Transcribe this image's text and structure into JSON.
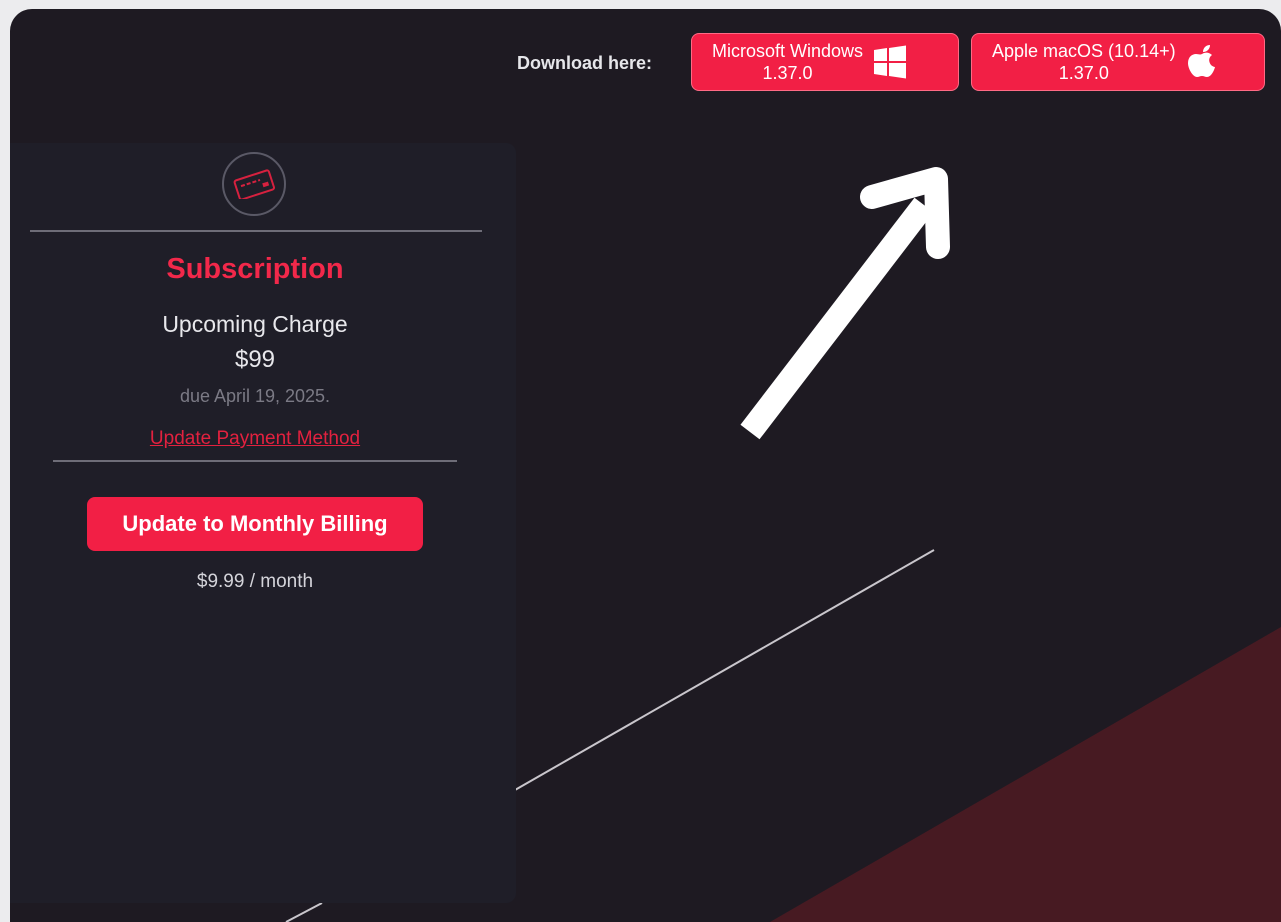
{
  "header": {
    "download_label": "Download here:",
    "windows": {
      "name": "Microsoft Windows",
      "version": "1.37.0",
      "icon": "windows-logo-icon"
    },
    "mac": {
      "name": "Apple macOS (10.14+)",
      "version": "1.37.0",
      "icon": "apple-logo-icon"
    }
  },
  "subscription": {
    "icon": "credit-card-icon",
    "title": "Subscription",
    "upcoming_label": "Upcoming Charge",
    "amount": "$99",
    "due_text": "due April 19, 2025.",
    "update_payment_link": "Update Payment Method",
    "monthly_button": "Update to Monthly Billing",
    "monthly_price": "$9.99 / month"
  },
  "annotation": {
    "icon": "arrow-up-right-icon"
  },
  "colors": {
    "accent": "#f21f45",
    "background": "#1e1a22",
    "card": "#1f1e28",
    "wedge": "#471a22"
  }
}
